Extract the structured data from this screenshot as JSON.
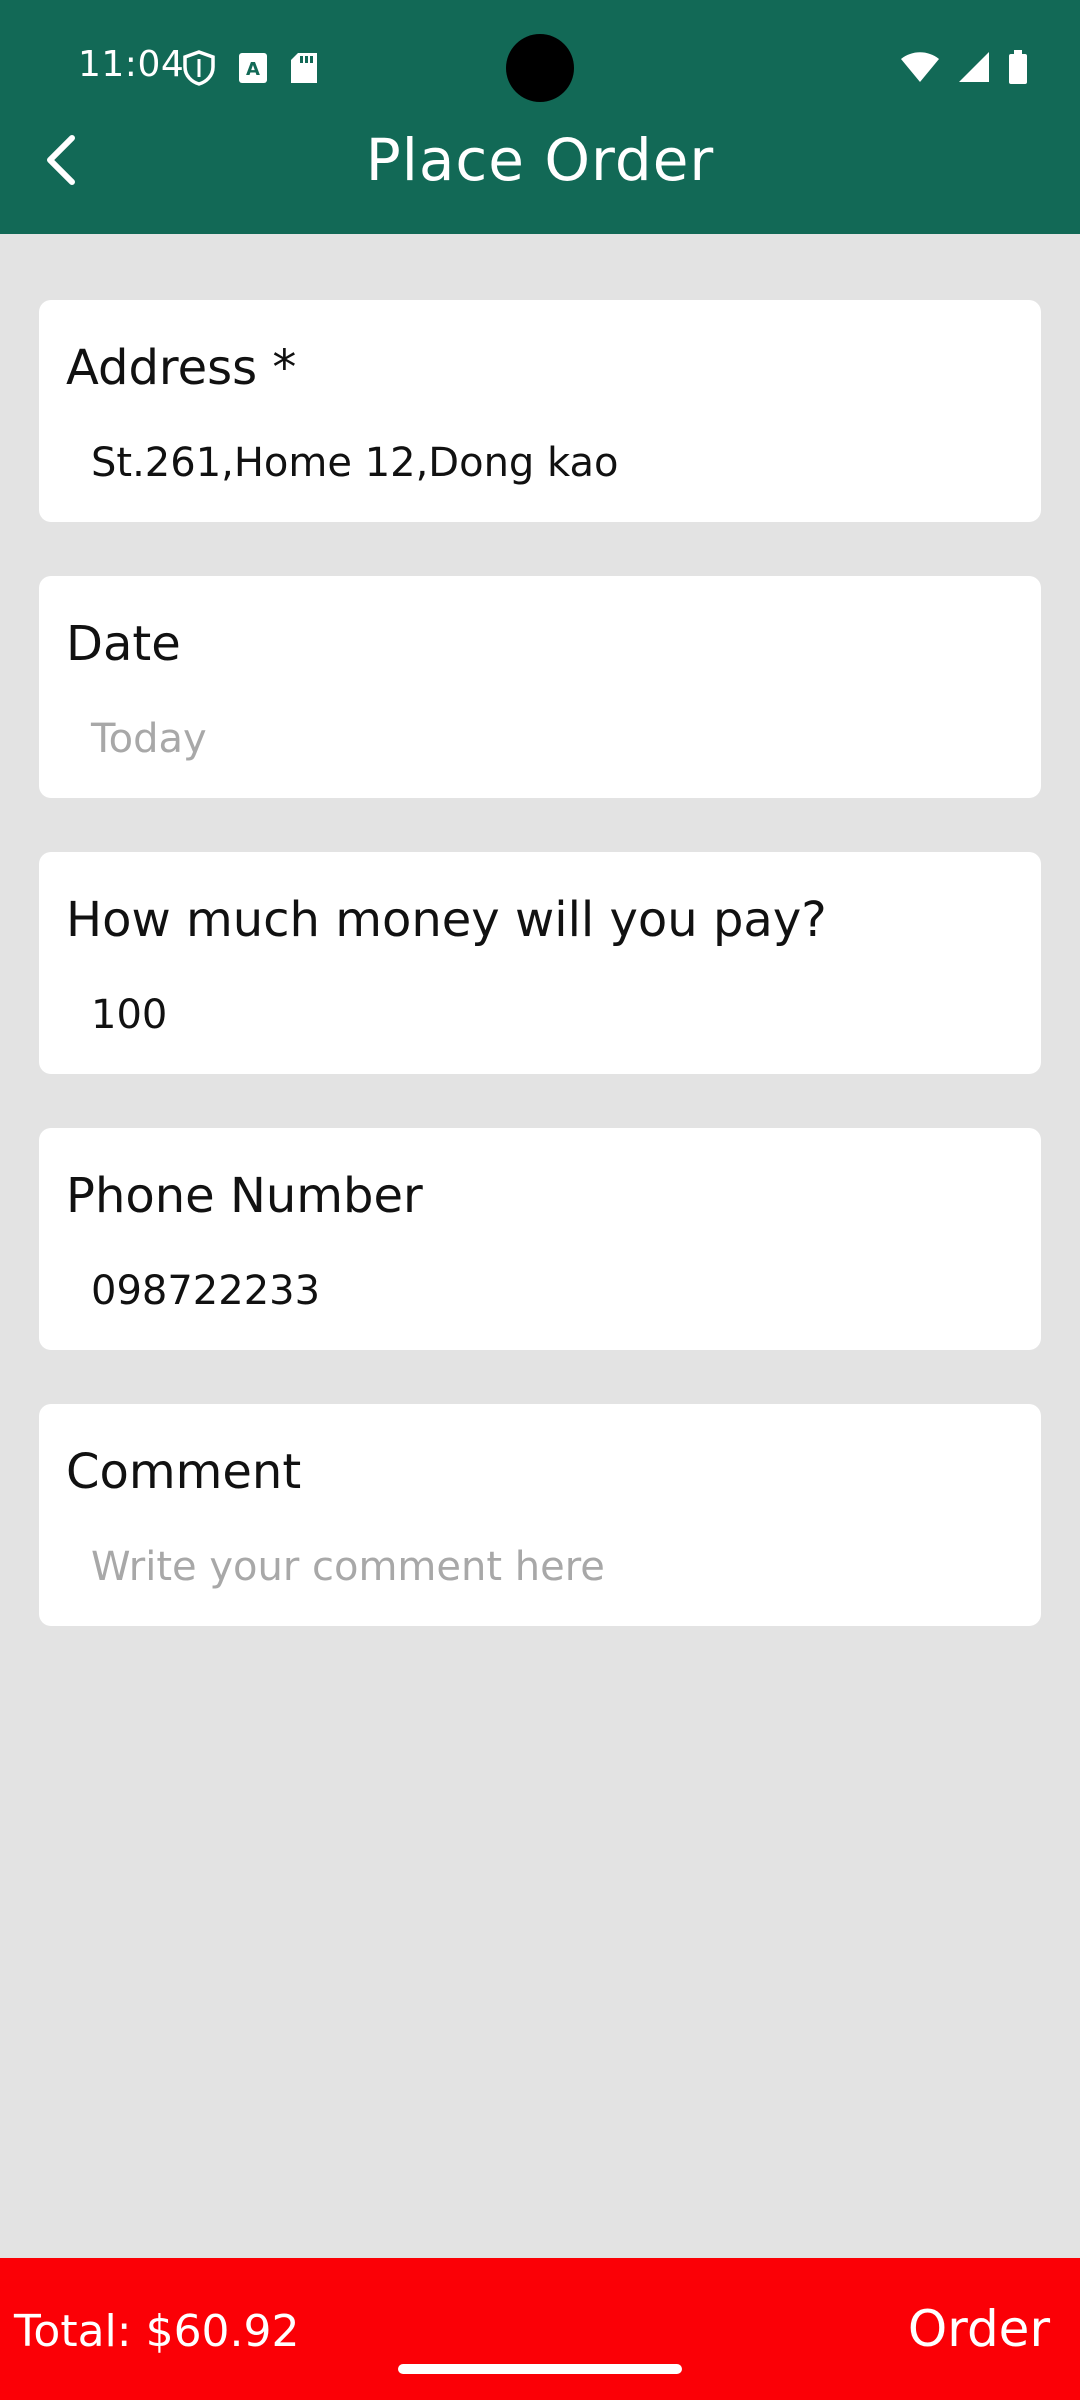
{
  "status_bar": {
    "time": "11:04",
    "left_icons": [
      "shield-icon",
      "a-keyboard-icon",
      "sd-card-icon"
    ],
    "right_icons": [
      "wifi-icon",
      "signal-icon",
      "battery-icon"
    ]
  },
  "header": {
    "title": "Place Order",
    "back_icon": "chevron-left-icon",
    "background_color": "#126956"
  },
  "form": {
    "address": {
      "label": "Address *",
      "value": "St.261,Home 12,Dong kao"
    },
    "date": {
      "label": "Date",
      "placeholder": "Today"
    },
    "payment": {
      "label": "How much money will you pay?",
      "value": "100"
    },
    "phone": {
      "label": "Phone Number",
      "value": "098722233"
    },
    "comment": {
      "label": "Comment",
      "placeholder": "Write your comment here"
    }
  },
  "bottom_bar": {
    "total": "Total: $60.92",
    "order_label": "Order",
    "background_color": "#fb0006"
  }
}
